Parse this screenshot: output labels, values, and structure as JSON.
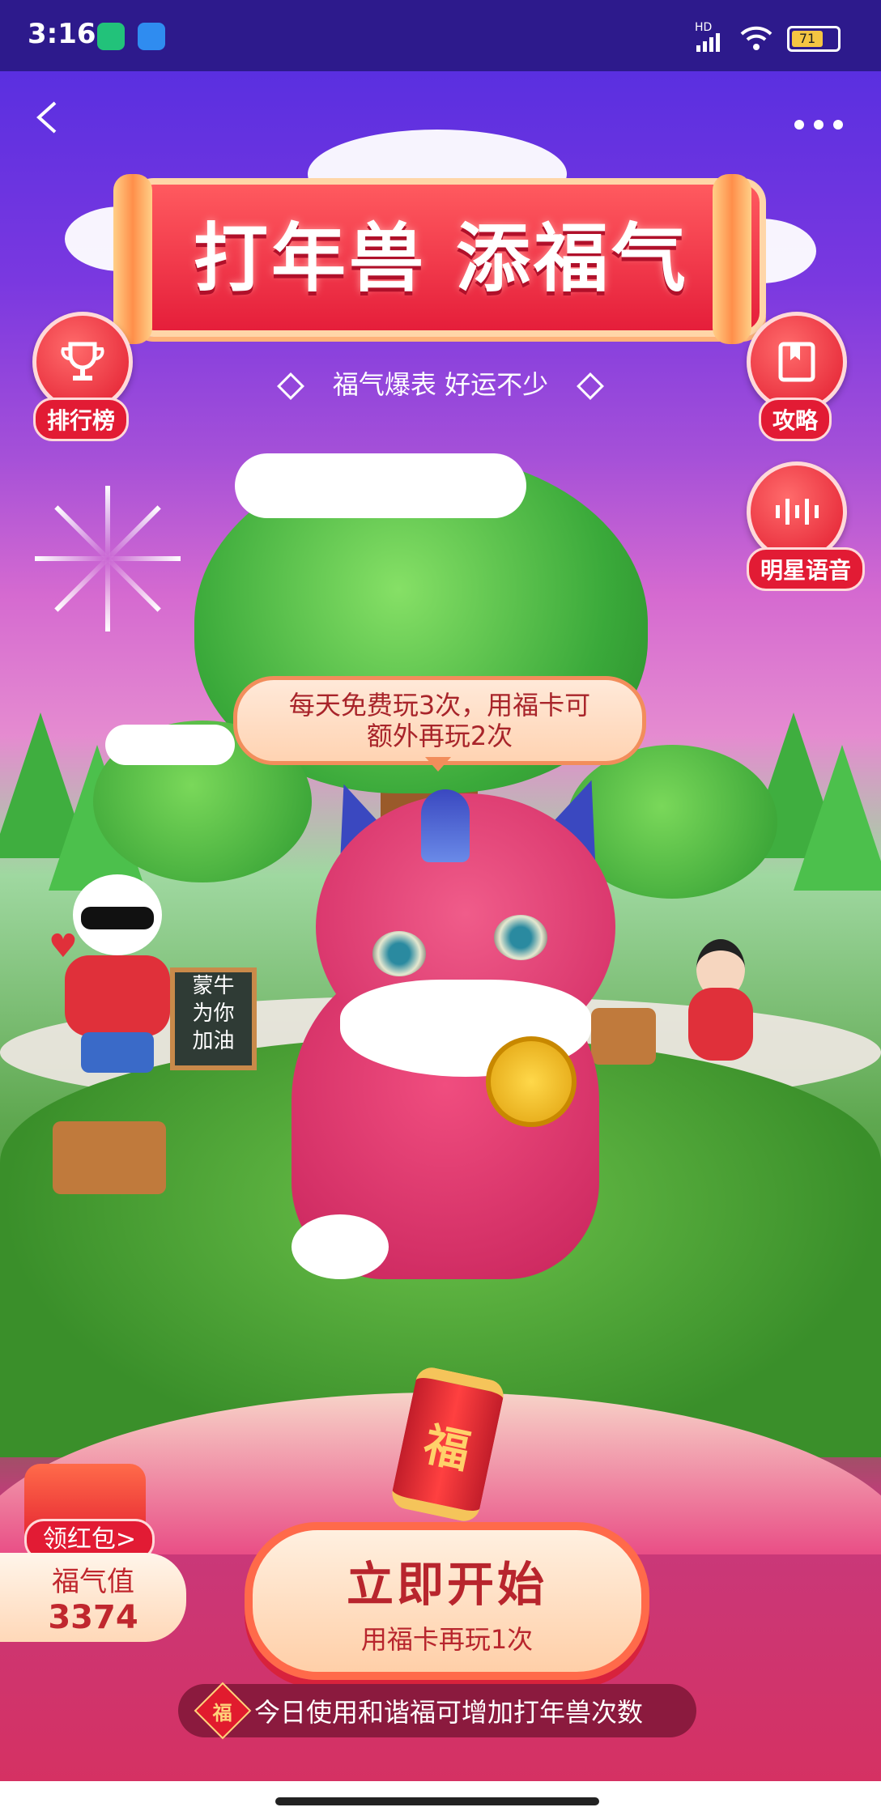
{
  "status_bar": {
    "time": "3:16",
    "battery": "71",
    "network": "HD"
  },
  "header": {
    "title": "打年兽 添福气",
    "subtitle": "福气爆表 好运不少"
  },
  "side_buttons": {
    "leaderboard": "排行榜",
    "guide": "攻略",
    "star_voice": "明星语音"
  },
  "scene": {
    "tooltip_line1": "每天免费玩3次，用福卡可",
    "tooltip_line2": "额外再玩2次",
    "sign_line1": "蒙牛",
    "sign_line2": "为你",
    "sign_line3": "加油",
    "firecracker_char": "福"
  },
  "fu_panel": {
    "red_packet_label": "领红包>",
    "label": "福气值",
    "value": "3374"
  },
  "start_button": {
    "label": "立即开始",
    "sub_label": "用福卡再玩1次"
  },
  "bottom_tip": {
    "badge": "福",
    "text": "今日使用和谐福可增加打年兽次数"
  },
  "colors": {
    "primary_red": "#e21b34",
    "background_top": "#5a2fe0",
    "grass": "#3d8a2e"
  }
}
